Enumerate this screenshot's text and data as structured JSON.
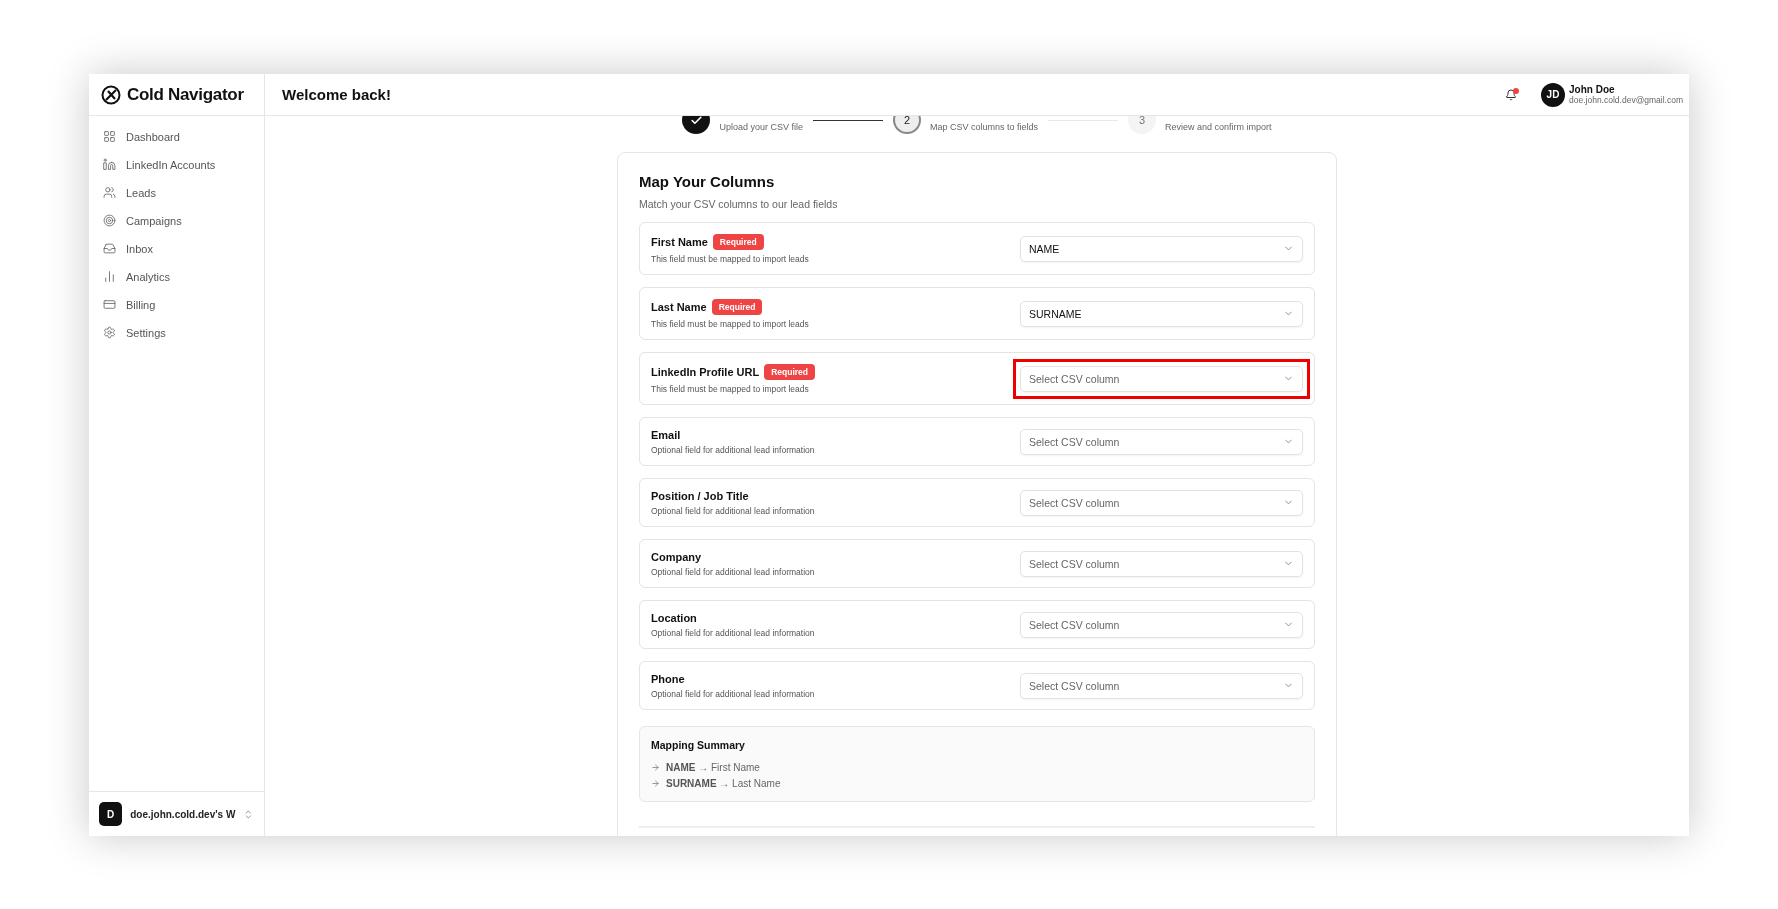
{
  "app": {
    "name": "Cold Navigator"
  },
  "sidebar": {
    "items": [
      {
        "label": "Dashboard",
        "selected": false
      },
      {
        "label": "LinkedIn Accounts",
        "selected": false
      },
      {
        "label": "Leads",
        "selected": false
      },
      {
        "label": "Campaigns",
        "selected": false
      },
      {
        "label": "Inbox",
        "selected": false
      },
      {
        "label": "Analytics",
        "selected": false
      },
      {
        "label": "Billing",
        "selected": false
      },
      {
        "label": "Settings",
        "selected": false
      }
    ],
    "workspace": {
      "initial": "D",
      "name": "doe.john.cold.dev's W"
    }
  },
  "header": {
    "title": "Welcome back!",
    "unread_notifications": true,
    "user": {
      "initials": "JD",
      "name": "John Doe",
      "email": "doe.john.cold.dev@gmail.com"
    }
  },
  "stepper": [
    {
      "subtitle": "Upload your CSV file",
      "kind": "done"
    },
    {
      "number": "2",
      "subtitle": "Map CSV columns to fields",
      "kind": "current"
    },
    {
      "number": "3",
      "subtitle": "Review and confirm import",
      "kind": "pending"
    }
  ],
  "card": {
    "title": "Map Your Columns",
    "subtitle": "Match your CSV columns to our lead fields",
    "fields": [
      {
        "label": "First Name",
        "badge": "Required",
        "hint": "This field must be mapped to import leads",
        "value": "NAME",
        "highlighted": false
      },
      {
        "label": "Last Name",
        "badge": "Required",
        "hint": "This field must be mapped to import leads",
        "value": "SURNAME",
        "highlighted": false
      },
      {
        "label": "LinkedIn Profile URL",
        "badge": "Required",
        "hint": "This field must be mapped to import leads",
        "placeholder": "Select CSV column",
        "highlighted": true
      },
      {
        "label": "Email",
        "hint": "Optional field for additional lead information",
        "placeholder": "Select CSV column",
        "highlighted": false
      },
      {
        "label": "Position / Job Title",
        "hint": "Optional field for additional lead information",
        "placeholder": "Select CSV column",
        "highlighted": false
      },
      {
        "label": "Company",
        "hint": "Optional field for additional lead information",
        "placeholder": "Select CSV column",
        "highlighted": false
      },
      {
        "label": "Location",
        "hint": "Optional field for additional lead information",
        "placeholder": "Select CSV column",
        "highlighted": false
      },
      {
        "label": "Phone",
        "hint": "Optional field for additional lead information",
        "placeholder": "Select CSV column",
        "highlighted": false
      }
    ],
    "summary": {
      "title": "Mapping Summary",
      "items": [
        "**NAME** → First Name",
        "**SURNAME** → Last Name"
      ]
    }
  }
}
